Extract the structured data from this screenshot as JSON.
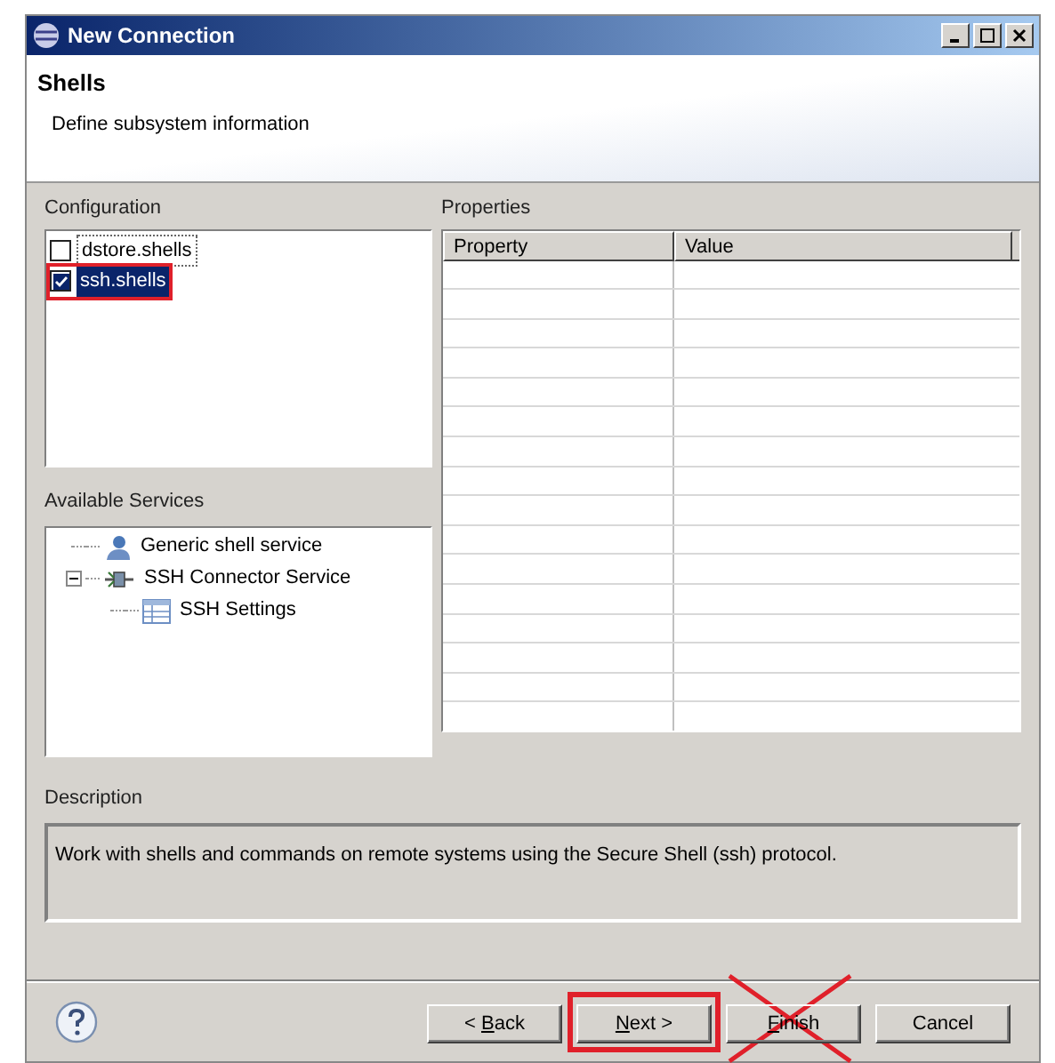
{
  "window": {
    "title": "New Connection"
  },
  "header": {
    "title": "Shells",
    "subtitle": "Define subsystem information"
  },
  "configuration": {
    "label": "Configuration",
    "items": [
      {
        "label": "dstore.shells",
        "checked": false,
        "selected": false,
        "annotated": false
      },
      {
        "label": "ssh.shells",
        "checked": true,
        "selected": true,
        "annotated": true
      }
    ]
  },
  "services": {
    "label": "Available Services",
    "items": [
      {
        "label": "Generic shell service",
        "kind": "service"
      },
      {
        "label": "SSH Connector Service",
        "kind": "connector",
        "expanded": true,
        "children": [
          {
            "label": "SSH Settings",
            "kind": "settings"
          }
        ]
      }
    ]
  },
  "properties": {
    "label": "Properties",
    "columns": [
      "Property",
      "Value"
    ]
  },
  "description": {
    "label": "Description",
    "text": "Work with shells and commands on remote systems using the Secure Shell (ssh) protocol."
  },
  "buttons": [
    {
      "label_before": "< ",
      "mnemonic": "B",
      "label_after": "ack",
      "annotated": false,
      "crossed_out": false
    },
    {
      "mnemonic": "N",
      "label_after": "ext >",
      "annotated": true,
      "crossed_out": false
    },
    {
      "mnemonic": "F",
      "label_after": "inish",
      "annotated": false,
      "crossed_out": true
    },
    {
      "label": "Cancel",
      "annotated": false,
      "crossed_out": false
    }
  ]
}
